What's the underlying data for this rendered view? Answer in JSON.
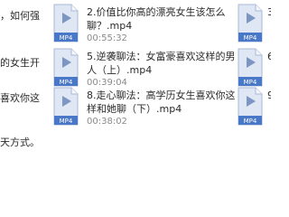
{
  "left_fragments": [
    "，如何强",
    "的女生开",
    "喜欢你这",
    "天方式。"
  ],
  "files": [
    {
      "line1": "2.价值比你高的漂亮女生该怎么",
      "line2": "聊？.mp4",
      "duration": "00:55:32",
      "ext": "MP4"
    },
    {
      "line1": "5.逆袭聊法：女富豪喜欢这样的男",
      "line2": "人（上）.mp4",
      "duration": "00:39:04",
      "ext": "MP4"
    },
    {
      "line1": "8.走心聊法：高学历女生喜欢你这",
      "line2": "样和她聊（下）.mp4",
      "duration": "00:38:02",
      "ext": "MP4"
    }
  ],
  "right_fragments": [
    "3",
    "6",
    "9"
  ],
  "colors": {
    "icon_body": "#dfe7f5",
    "icon_border": "#a9b9d6",
    "icon_badge": "#4a78c8",
    "play_triangle": "#7d95c2"
  }
}
